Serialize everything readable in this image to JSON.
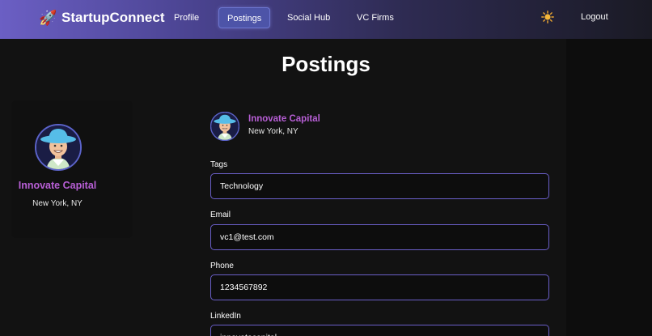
{
  "navbar": {
    "brand": "StartupConnect",
    "links": [
      {
        "label": "Profile",
        "active": false
      },
      {
        "label": "Postings",
        "active": true
      },
      {
        "label": "Social Hub",
        "active": false
      },
      {
        "label": "VC Firms",
        "active": false
      }
    ],
    "theme_icon": "sun-icon",
    "logout_label": "Logout"
  },
  "page": {
    "title": "Postings"
  },
  "profile_card": {
    "name": "Innovate Capital",
    "location": "New York, NY"
  },
  "posting": {
    "author": "Innovate Capital",
    "location": "New York, NY",
    "fields": [
      {
        "label": "Tags",
        "value": "Technology"
      },
      {
        "label": "Email",
        "value": "vc1@test.com"
      },
      {
        "label": "Phone",
        "value": "1234567892"
      },
      {
        "label": "LinkedIn",
        "value": "innovatecapital"
      }
    ]
  },
  "colors": {
    "accent": "#b85fd6",
    "border": "#6a5fc8",
    "nav_start": "#6b5fc4",
    "nav_end": "#1a1a24"
  }
}
